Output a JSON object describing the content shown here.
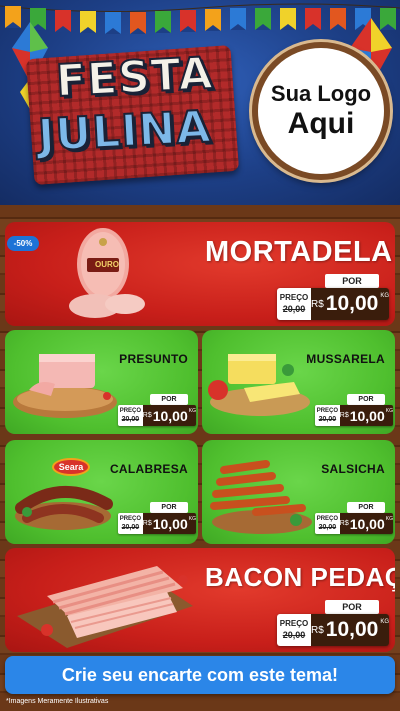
{
  "header": {
    "title_line1": "FESTA",
    "title_line2": "JULINA",
    "logo_line1": "Sua Logo",
    "logo_line2": "Aqui"
  },
  "featured_top": {
    "name": "MORTADELA",
    "discount_badge": "-50%",
    "brand_label": "OURO",
    "price_tag": {
      "por": "POR",
      "preco": "PREÇO",
      "old": "20,00",
      "old_prefix": "R$",
      "currency": "R$",
      "amount": "10,00",
      "unit": "KG"
    }
  },
  "grid": [
    {
      "name": "PRESUNTO",
      "price_tag": {
        "por": "POR",
        "preco": "PREÇO",
        "old": "20,00",
        "old_prefix": "R$",
        "currency": "R$",
        "amount": "10,00",
        "unit": "KG"
      }
    },
    {
      "name": "MUSSARELA",
      "price_tag": {
        "por": "POR",
        "preco": "PREÇO",
        "old": "20,00",
        "old_prefix": "R$",
        "currency": "R$",
        "amount": "10,00",
        "unit": "KG"
      }
    },
    {
      "name": "CALABRESA",
      "brand_label": "Seara",
      "price_tag": {
        "por": "POR",
        "preco": "PREÇO",
        "old": "20,00",
        "old_prefix": "R$",
        "currency": "R$",
        "amount": "10,00",
        "unit": "KG"
      }
    },
    {
      "name": "SALSICHA",
      "price_tag": {
        "por": "POR",
        "preco": "PREÇO",
        "old": "20,00",
        "old_prefix": "R$",
        "currency": "R$",
        "amount": "10,00",
        "unit": "KG"
      }
    }
  ],
  "featured_bottom": {
    "name": "BACON PEDAÇO",
    "price_tag": {
      "por": "POR",
      "preco": "PREÇO",
      "old": "20,00",
      "old_prefix": "R$",
      "currency": "R$",
      "amount": "10,00",
      "unit": "KG"
    }
  },
  "cta": "Crie seu encarte com este tema!",
  "footnote": "*Imagens Meramente Ilustrativas",
  "colors": {
    "header_blue": "#1d3f86",
    "card_red": "#c81f1a",
    "card_green": "#4fbf2e",
    "tag_brown": "#3a1d0c",
    "cta_blue": "#2b86e8"
  }
}
